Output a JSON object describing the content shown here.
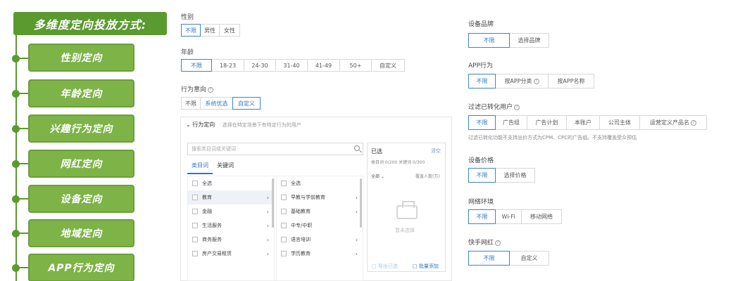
{
  "left": {
    "title": "多维度定向投放方式:",
    "items": [
      "性别定向",
      "年龄定向",
      "兴趣行为定向",
      "网红定向",
      "设备定向",
      "地域定向",
      "APP行为定向"
    ]
  },
  "gender": {
    "label": "性别",
    "options": [
      "不限",
      "男性",
      "女性"
    ]
  },
  "age": {
    "label": "年龄",
    "options": [
      "不限",
      "18-23",
      "24-30",
      "31-40",
      "41-49",
      "50+",
      "自定义"
    ]
  },
  "intent": {
    "label": "行为意向",
    "options": [
      "不限",
      "系统优选",
      "自定义"
    ]
  },
  "behavior": {
    "title": "行为定向",
    "subtitle": "选择在特定场景下有特定行为的用户",
    "search_placeholder": "搜索类目词或关键词",
    "tabs": [
      "类目词",
      "关键词"
    ],
    "col1": [
      "全选",
      "教育",
      "金融",
      "生活服务",
      "商务服务",
      "房产交易租赁"
    ],
    "col2": [
      "全选",
      "早教与学前教育",
      "基础教育",
      "中专/中职",
      "语言培训",
      "学历教育"
    ],
    "selected_title": "已选",
    "clear": "清空",
    "count": "类目词 0/200  关键词 0/300",
    "all": "全部",
    "coverage": "覆盖人数(万)",
    "empty": "暂未选择",
    "export": "导出已选",
    "bulk_add": "批量添加"
  },
  "brand": {
    "label": "设备品牌",
    "options": [
      "不限",
      "选择品牌"
    ]
  },
  "app": {
    "label": "APP行为",
    "options": [
      "不限",
      "按APP分类",
      "按APP名称"
    ]
  },
  "filter": {
    "label": "过滤已转化用户",
    "options": [
      "不限",
      "广告组",
      "广告计划",
      "本账户",
      "公司主体",
      "运营定义产品名"
    ],
    "note": "过滤已转化功能不支持出价方式为CPM、CPC的广告组。不支持覆盖受众预估"
  },
  "price": {
    "label": "设备价格",
    "options": [
      "不限",
      "选择价格"
    ]
  },
  "network": {
    "label": "网络环境",
    "options": [
      "不限",
      "Wi-Fi",
      "移动网络"
    ]
  },
  "kuaishou": {
    "label": "快手网红",
    "options": [
      "不限",
      "自定义"
    ]
  },
  "colors": {
    "green_dark": "#5a9a2f",
    "green": "#7db347",
    "accent": "#2f78c0"
  }
}
